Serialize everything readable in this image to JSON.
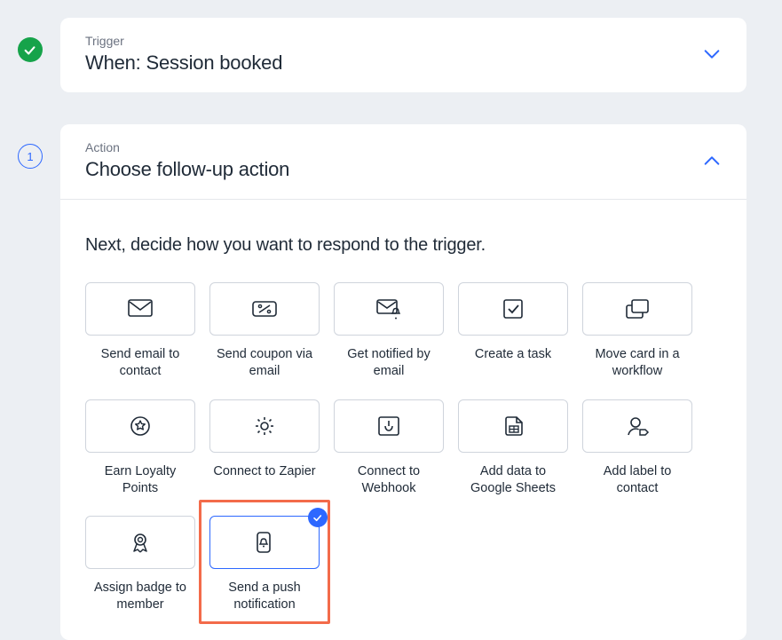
{
  "trigger_step": {
    "label": "Trigger",
    "title": "When: Session booked"
  },
  "action_step": {
    "step_number": "1",
    "label": "Action",
    "title": "Choose follow-up action",
    "prompt": "Next, decide how you want to respond to the trigger.",
    "options": [
      {
        "id": "send-email",
        "label": "Send email to contact",
        "icon": "envelope-icon",
        "selected": false
      },
      {
        "id": "send-coupon",
        "label": "Send coupon via email",
        "icon": "coupon-icon",
        "selected": false
      },
      {
        "id": "get-notified",
        "label": "Get notified by email",
        "icon": "envelope-bell-icon",
        "selected": false
      },
      {
        "id": "create-task",
        "label": "Create a task",
        "icon": "checkbox-icon",
        "selected": false
      },
      {
        "id": "move-card",
        "label": "Move card in a workflow",
        "icon": "stack-cards-icon",
        "selected": false
      },
      {
        "id": "earn-loyalty",
        "label": "Earn Loyalty Points",
        "icon": "star-circle-icon",
        "selected": false
      },
      {
        "id": "connect-zapier",
        "label": "Connect to Zapier",
        "icon": "gear-icon",
        "selected": false
      },
      {
        "id": "connect-webhook",
        "label": "Connect to Webhook",
        "icon": "webhook-icon",
        "selected": false
      },
      {
        "id": "add-sheets",
        "label": "Add data to Google Sheets",
        "icon": "sheets-icon",
        "selected": false
      },
      {
        "id": "add-label",
        "label": "Add label to contact",
        "icon": "contact-tag-icon",
        "selected": false
      },
      {
        "id": "assign-badge",
        "label": "Assign badge to member",
        "icon": "ribbon-icon",
        "selected": false
      },
      {
        "id": "push-notification",
        "label": "Send a push notification",
        "icon": "phone-bell-icon",
        "selected": true
      }
    ]
  },
  "colors": {
    "accent": "#2d68ff",
    "success": "#16a34a",
    "highlight": "#f36b4a"
  }
}
